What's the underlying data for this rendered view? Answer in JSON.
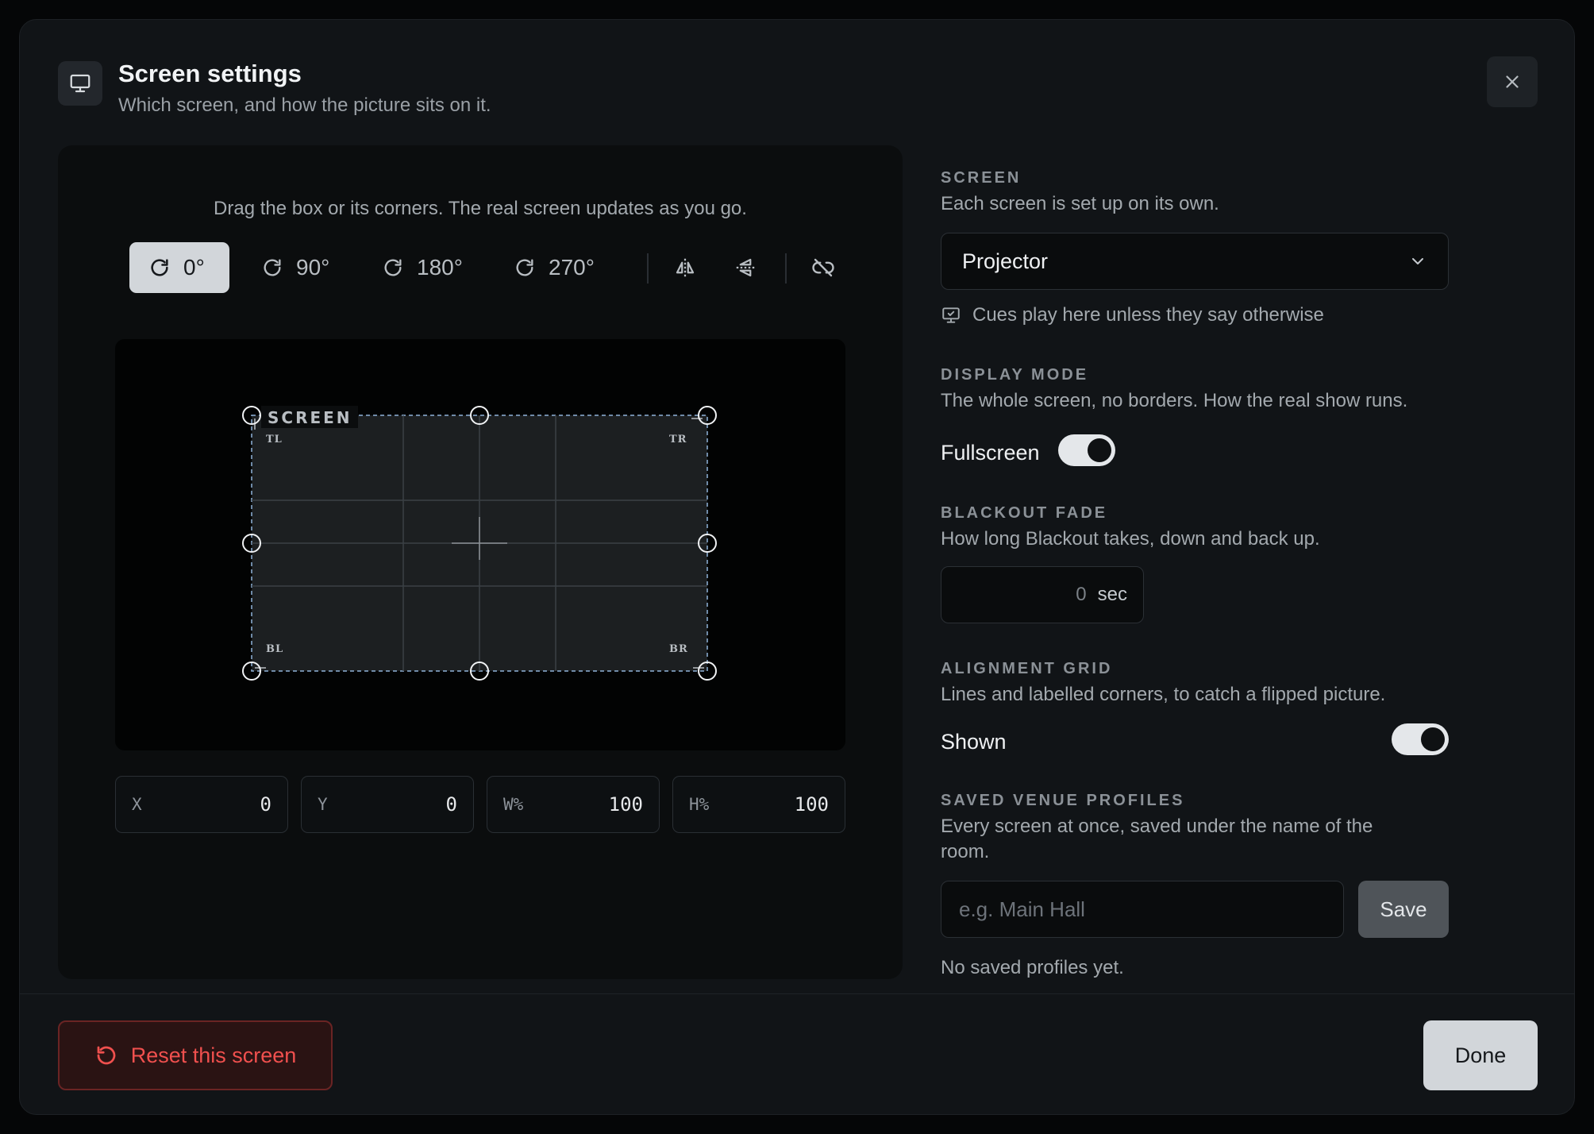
{
  "dialog": {
    "title": "Screen settings",
    "subtitle": "Which screen, and how the picture sits on it."
  },
  "editor": {
    "hint": "Drag the box or its corners. The real screen updates as you go.",
    "rotations": [
      "0°",
      "90°",
      "180°",
      "270°"
    ],
    "active_rotation": "0°",
    "screen_label": "SCREEN",
    "corner_labels": {
      "tl": "TL",
      "tr": "TR",
      "bl": "BL",
      "br": "BR"
    },
    "fields": [
      {
        "label": "X",
        "value": "0"
      },
      {
        "label": "Y",
        "value": "0"
      },
      {
        "label": "W%",
        "value": "100"
      },
      {
        "label": "H%",
        "value": "100"
      }
    ]
  },
  "screen": {
    "label": "SCREEN",
    "desc": "Each screen is set up on its own.",
    "selected": "Projector",
    "default_note": "Cues play here unless they say otherwise"
  },
  "display_mode": {
    "label": "DISPLAY MODE",
    "desc": "The whole screen, no borders. How the real show runs.",
    "toggle_label": "Fullscreen",
    "enabled": true
  },
  "blackout_fade": {
    "label": "BLACKOUT FADE",
    "desc": "How long Blackout takes, down and back up.",
    "value": "0",
    "unit": "sec"
  },
  "alignment_grid": {
    "label": "ALIGNMENT GRID",
    "desc": "Lines and labelled corners, to catch a flipped picture.",
    "toggle_label": "Shown",
    "enabled": true
  },
  "profiles": {
    "label": "SAVED VENUE PROFILES",
    "desc": "Every screen at once, saved under the name of the room.",
    "placeholder": "e.g. Main Hall",
    "save_label": "Save",
    "empty": "No saved profiles yet."
  },
  "footer": {
    "reset_label": "Reset this screen",
    "done_label": "Done",
    "reset_color": "#f0504e"
  },
  "icons": [
    "monitor-icon",
    "close-icon",
    "rotate-icon",
    "flip-horizontal-icon",
    "flip-vertical-icon",
    "unlink-icon",
    "chevron-down-icon",
    "monitor-check-icon",
    "reset-icon"
  ]
}
